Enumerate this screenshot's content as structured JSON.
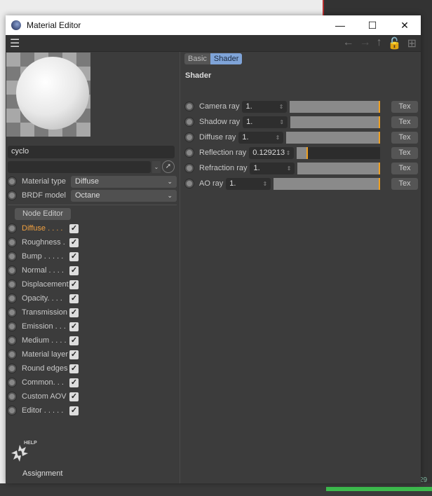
{
  "window": {
    "title": "Material Editor"
  },
  "background": {
    "status_number": "29"
  },
  "left": {
    "material_name": "cyclo",
    "link_value": "",
    "material_type": {
      "label": "Material type",
      "value": "Diffuse"
    },
    "brdf_model": {
      "label": "BRDF model",
      "value": "Octane"
    },
    "node_editor_label": "Node Editor",
    "channels": [
      {
        "label": "Diffuse . . . .",
        "checked": true,
        "active": true
      },
      {
        "label": "Roughness  .",
        "checked": true
      },
      {
        "label": "Bump . . . . .",
        "checked": true
      },
      {
        "label": "Normal . . . .",
        "checked": true
      },
      {
        "label": "Displacement",
        "checked": true
      },
      {
        "label": "Opacity. . . .",
        "checked": true
      },
      {
        "label": "Transmission",
        "checked": true
      },
      {
        "label": "Emission . . .",
        "checked": true
      },
      {
        "label": "Medium . . . .",
        "checked": true
      },
      {
        "label": "Material layer",
        "checked": true
      },
      {
        "label": "Round edges",
        "checked": true
      },
      {
        "label": "Common. . .",
        "checked": true
      },
      {
        "label": "Custom AOV",
        "checked": true
      },
      {
        "label": "Editor . . . . .",
        "checked": true
      }
    ],
    "help_label": "HELP",
    "assignment_label": "Assignment"
  },
  "right": {
    "tabs": [
      {
        "label": "Basic",
        "active": false
      },
      {
        "label": "Shader",
        "active": true
      }
    ],
    "section_title": "Shader",
    "rows": [
      {
        "label": "Camera ray",
        "value": "1.",
        "fraction": 1.0,
        "tex": "Tex"
      },
      {
        "label": "Shadow ray",
        "value": "1.",
        "fraction": 1.0,
        "tex": "Tex"
      },
      {
        "label": "Diffuse ray",
        "value": "1.",
        "fraction": 1.0,
        "tex": "Tex"
      },
      {
        "label": "Reflection ray",
        "value": "0.129213",
        "fraction": 0.129213,
        "tex": "Tex"
      },
      {
        "label": "Refraction ray",
        "value": "1.",
        "fraction": 1.0,
        "tex": "Tex"
      },
      {
        "label": "AO ray",
        "value": "1.",
        "fraction": 1.0,
        "tex": "Tex"
      }
    ]
  },
  "colors": {
    "accent_orange": "#f0a020",
    "active_tab": "#7fa4d8",
    "active_channel": "#f0a040"
  }
}
